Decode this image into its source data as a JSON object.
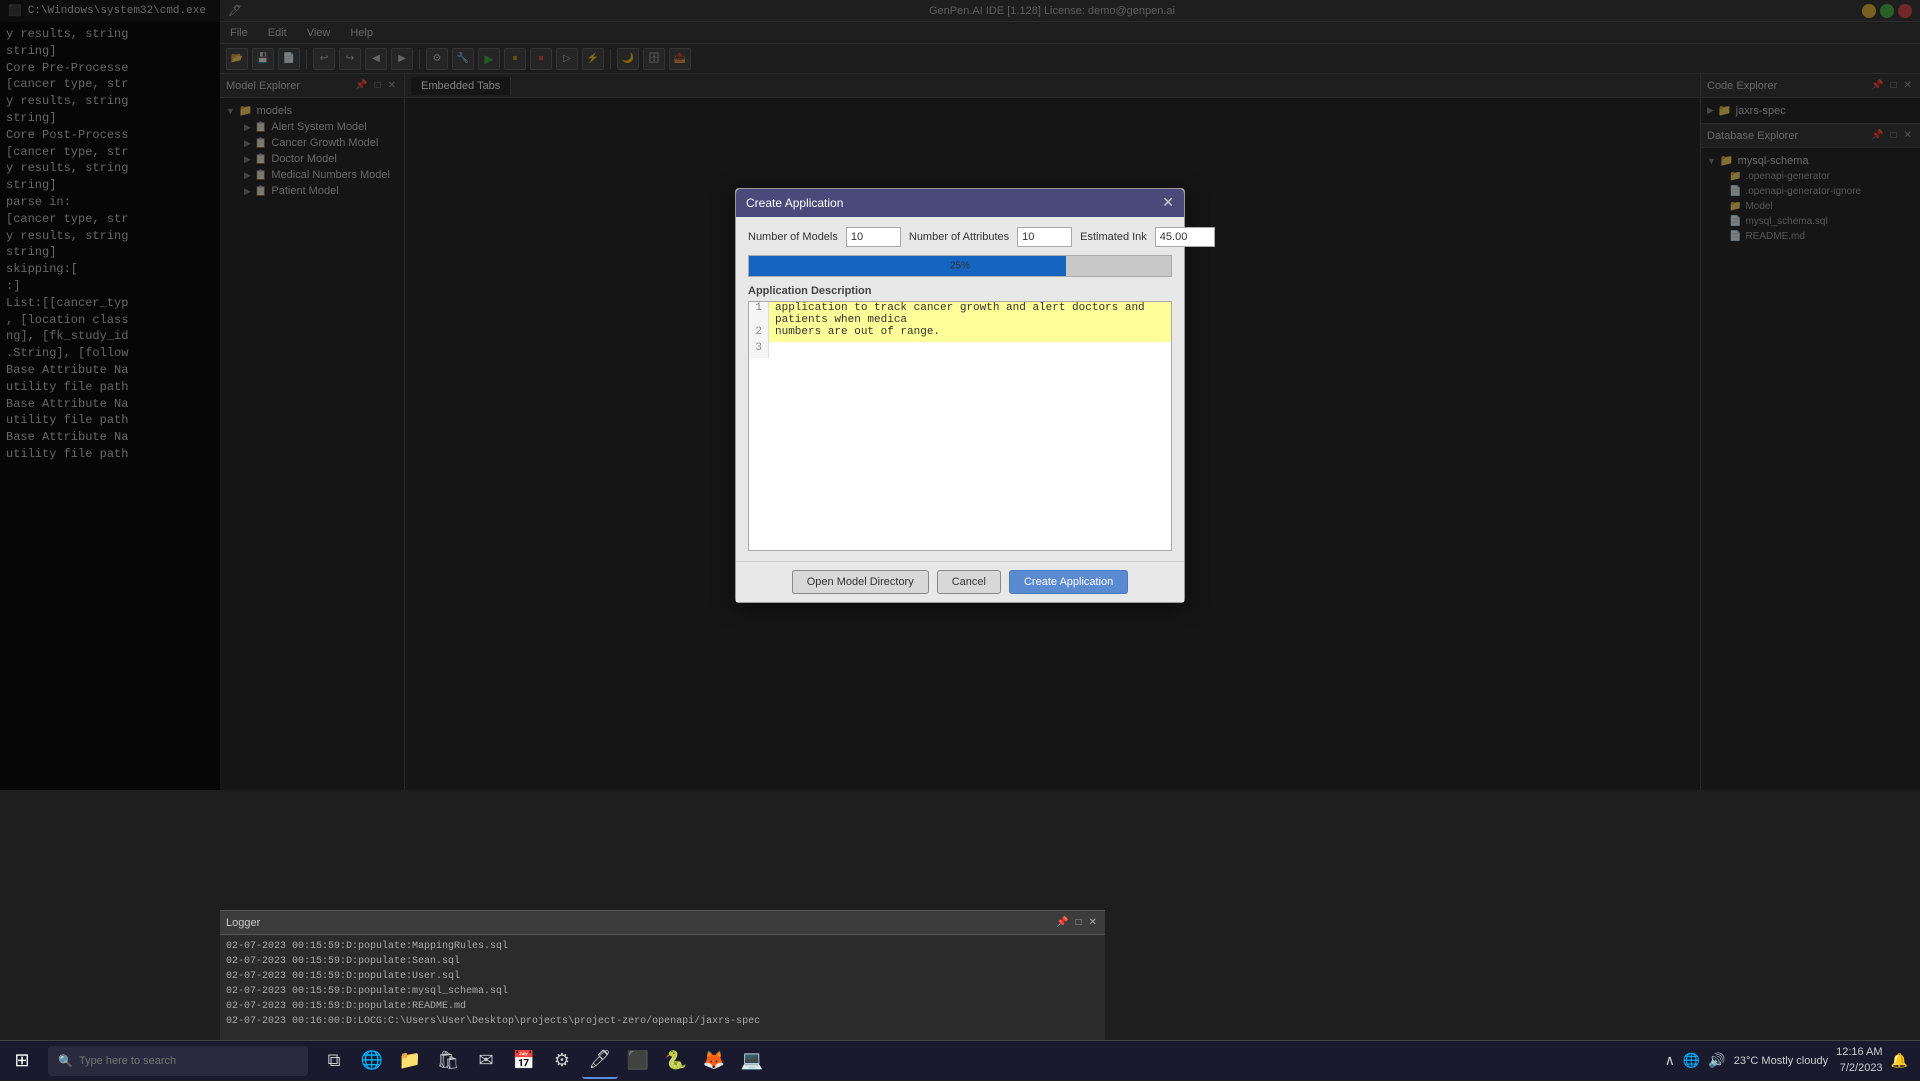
{
  "app": {
    "title": "GenPen.AI IDE [1.128] License: demo@genpen.ai"
  },
  "cmd": {
    "title": "C:\\Windows\\system32\\cmd.exe",
    "content": "y results, string\nstring]\nCore Pre-Processe\n[cancer type, str\ny results, string\nstring]\nCore Post-Process\n[cancer type, str\ny results, string\nstring]\nparse in:\n[cancer type, str\ny results, string\nstring]\nskipping:[\n:]\nList:[[cancer_typ\n, [location class\nng], [fk_study_id\n.String], [follow\nBase Attribute Na\nutility file path\nBase Attribute Na\nutility file path\nBase Attribute Na\nutility file path"
  },
  "menu": {
    "file": "File",
    "edit": "Edit",
    "view": "View",
    "help": "Help"
  },
  "model_explorer": {
    "title": "Model Explorer",
    "root": {
      "label": "models",
      "items": [
        "Alert System Model",
        "Cancer Growth Model",
        "Doctor Model",
        "Medical Numbers Model",
        "Patient Model"
      ]
    }
  },
  "embedded_tabs": {
    "title": "Embedded Tabs"
  },
  "code_explorer": {
    "title": "Code Explorer",
    "items": [
      "jaxrs-spec"
    ]
  },
  "database_explorer": {
    "title": "Database Explorer",
    "root": "mysql-schema",
    "items": [
      ".openapi-generator",
      ".openapi-generator-ignore",
      "Model",
      "mysql_schema.sql",
      "README.md"
    ]
  },
  "logger": {
    "title": "Logger",
    "entries": [
      "02-07-2023 00:15:59:D:populate:MappingRules.sql",
      "02-07-2023 00:15:59:D:populate:Sean.sql",
      "02-07-2023 00:15:59:D:populate:User.sql",
      "02-07-2023 00:15:59:D:populate:mysql_schema.sql",
      "02-07-2023 00:15:59:D:populate:README.md",
      "02-07-2023 00:16:00:D:LOCG:C:\\Users\\User\\Desktop\\projects\\project-zero/openapi/jaxrs-spec"
    ]
  },
  "dialog": {
    "title": "Create Application",
    "num_models_label": "Number of Models",
    "num_models_value": "10",
    "num_attributes_label": "Number of Attributes",
    "num_attributes_value": "10",
    "estimated_ink_label": "Estimated Ink",
    "estimated_ink_value": "45.00",
    "progress_percent": 75,
    "progress_label": "25%",
    "section_label": "Application Description",
    "description_lines": [
      "application to track cancer growth and alert doctors and patients when medica",
      "numbers are out of range."
    ],
    "btn_open_model": "Open Model Directory",
    "btn_cancel": "Cancel",
    "btn_create": "Create Application"
  },
  "taskbar": {
    "search_placeholder": "Type here to search",
    "weather": "23°C  Mostly cloudy",
    "time": "12:16 AM",
    "date": "7/2/2023"
  }
}
